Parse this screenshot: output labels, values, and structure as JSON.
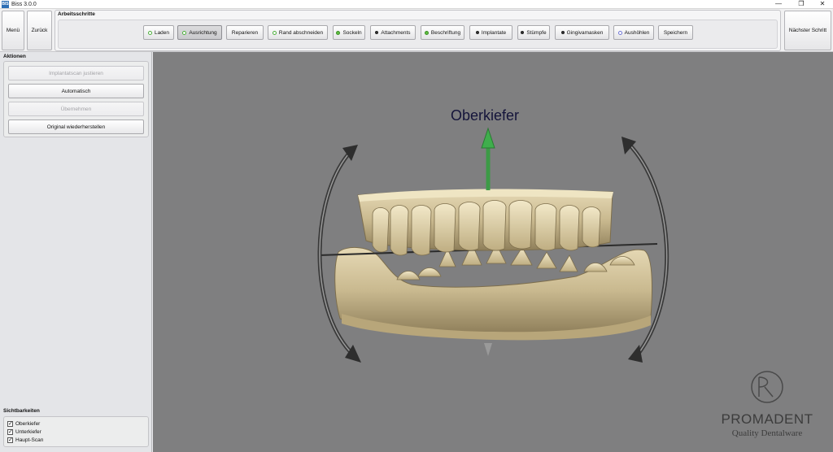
{
  "window": {
    "icon_text": "BIS",
    "title": "Biss 3.0.0",
    "controls": {
      "minimize": "—",
      "maximize": "❐",
      "close": "✕"
    }
  },
  "toolbar": {
    "menu_label": "Menü",
    "back_label": "Zurück",
    "next_label": "Nächster Schritt",
    "steps_title": "Arbeitsschritte",
    "steps": [
      {
        "label": "Laden",
        "status": "green"
      },
      {
        "label": "Ausrichtung",
        "status": "green",
        "active": true
      },
      {
        "label": "Reparieren",
        "status": "none"
      },
      {
        "label": "Rand abschneiden",
        "status": "green"
      },
      {
        "label": "Sockeln",
        "status": "greenfill"
      },
      {
        "label": "Attachments",
        "status": "dark"
      },
      {
        "label": "Beschriftung",
        "status": "greenfill"
      },
      {
        "label": "Implantate",
        "status": "dark"
      },
      {
        "label": "Stümpfe",
        "status": "dark"
      },
      {
        "label": "Gingivamasken",
        "status": "dark"
      },
      {
        "label": "Aushöhlen",
        "status": "blue"
      },
      {
        "label": "Speichern",
        "status": "none"
      }
    ]
  },
  "actions": {
    "title": "Aktionen",
    "buttons": [
      {
        "label": "Implantatscan justieren",
        "enabled": false
      },
      {
        "label": "Automatisch",
        "enabled": true
      },
      {
        "label": "Übernehmen",
        "enabled": false
      },
      {
        "label": "Original wiederherstellen",
        "enabled": true
      }
    ]
  },
  "visibility": {
    "title": "Sichtbarkeiten",
    "items": [
      {
        "label": "Oberkiefer",
        "checked": true
      },
      {
        "label": "Unterkiefer",
        "checked": true
      },
      {
        "label": "Haupt-Scan",
        "checked": true
      }
    ]
  },
  "viewport": {
    "axis_label": "Oberkiefer",
    "background_color": "#7f7f80",
    "logo_monogram": "DR",
    "logo_name": "PROMADENT",
    "logo_tagline": "Quality Dentalware"
  }
}
